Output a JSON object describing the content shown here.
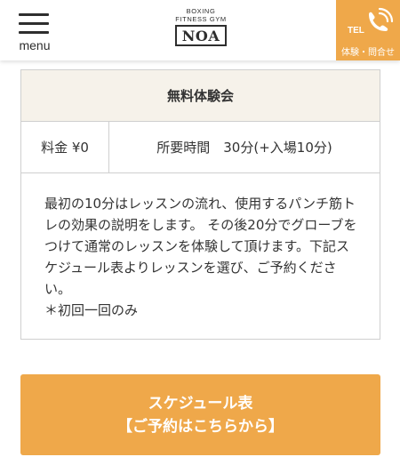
{
  "header": {
    "menu_label": "menu",
    "logo": {
      "line1": "BOXING",
      "line2": "FITNESS GYM",
      "name": "NOA"
    },
    "tel": {
      "label": "TEL",
      "sub": "体験・問合せ"
    }
  },
  "trial_table": {
    "title": "無料体験会",
    "price": "料金 ¥0",
    "duration": "所要時間　30分(+入場10分)",
    "description": "最初の10分はレッスンの流れ、使用するパンチ筋トレの効果の説明をします。 その後20分でグローブをつけて通常のレッスンを体験して頂けます。下記スケジュール表よりレッスンを選び、ご予約ください。",
    "note": "＊初回一回のみ"
  },
  "cta": {
    "line1": "スケジュール表",
    "line2": "【ご予約はこちらから】"
  },
  "colors": {
    "accent": "#efa84a",
    "table_header_bg": "#f6f2ea",
    "border": "#cfcfcf"
  }
}
